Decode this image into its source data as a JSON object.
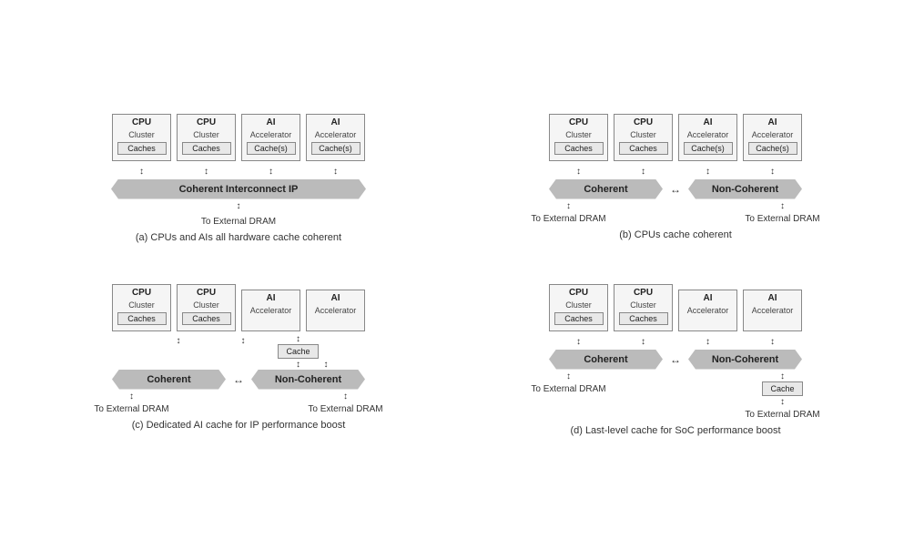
{
  "diagrams": [
    {
      "id": "a",
      "caption": "(a) CPUs and AIs all hardware cache coherent",
      "units": [
        {
          "title": "CPU",
          "subtitle": "Cluster",
          "cache": "Caches"
        },
        {
          "title": "CPU",
          "subtitle": "Cluster",
          "cache": "Caches"
        },
        {
          "title": "AI",
          "subtitle": "Accelerator",
          "cache": "Cache(s)"
        },
        {
          "title": "AI",
          "subtitle": "Accelerator",
          "cache": "Cache(s)"
        }
      ],
      "interconnect_type": "single",
      "interconnect_label": "Coherent Interconnect IP",
      "dram": [
        {
          "text": "To External DRAM"
        }
      ]
    },
    {
      "id": "b",
      "caption": "(b) CPUs cache coherent",
      "units": [
        {
          "title": "CPU",
          "subtitle": "Cluster",
          "cache": "Caches"
        },
        {
          "title": "CPU",
          "subtitle": "Cluster",
          "cache": "Caches"
        },
        {
          "title": "AI",
          "subtitle": "Accelerator",
          "cache": "Cache(s)"
        },
        {
          "title": "AI",
          "subtitle": "Accelerator",
          "cache": "Cache(s)"
        }
      ],
      "interconnect_type": "dual",
      "interconnect_left": "Coherent",
      "interconnect_right": "Non-Coherent",
      "dram": [
        {
          "text": "To External DRAM"
        },
        {
          "text": "To External DRAM"
        }
      ]
    },
    {
      "id": "c",
      "caption": "(c) Dedicated AI cache for IP performance boost",
      "units": [
        {
          "title": "CPU",
          "subtitle": "Cluster",
          "cache": "Caches"
        },
        {
          "title": "CPU",
          "subtitle": "Cluster",
          "cache": "Caches"
        },
        {
          "title": "AI",
          "subtitle": "Accelerator",
          "cache": ""
        },
        {
          "title": "AI",
          "subtitle": "Accelerator",
          "cache": ""
        }
      ],
      "interconnect_type": "dual",
      "interconnect_left": "Coherent",
      "interconnect_right": "Non-Coherent",
      "has_ai_cache": true,
      "ai_cache_label": "Cache",
      "dram": [
        {
          "text": "To External DRAM"
        },
        {
          "text": "To External DRAM"
        }
      ]
    },
    {
      "id": "d",
      "caption": "(d) Last-level cache for SoC performance boost",
      "units": [
        {
          "title": "CPU",
          "subtitle": "Cluster",
          "cache": "Caches"
        },
        {
          "title": "CPU",
          "subtitle": "Cluster",
          "cache": "Caches"
        },
        {
          "title": "AI",
          "subtitle": "Accelerator",
          "cache": ""
        },
        {
          "title": "AI",
          "subtitle": "Accelerator",
          "cache": ""
        }
      ],
      "interconnect_type": "dual",
      "interconnect_left": "Coherent",
      "interconnect_right": "Non-Coherent",
      "has_llc": true,
      "llc_label": "Cache",
      "dram": [
        {
          "text": "To External DRAM"
        },
        {
          "text": "To External DRAM"
        }
      ]
    }
  ]
}
